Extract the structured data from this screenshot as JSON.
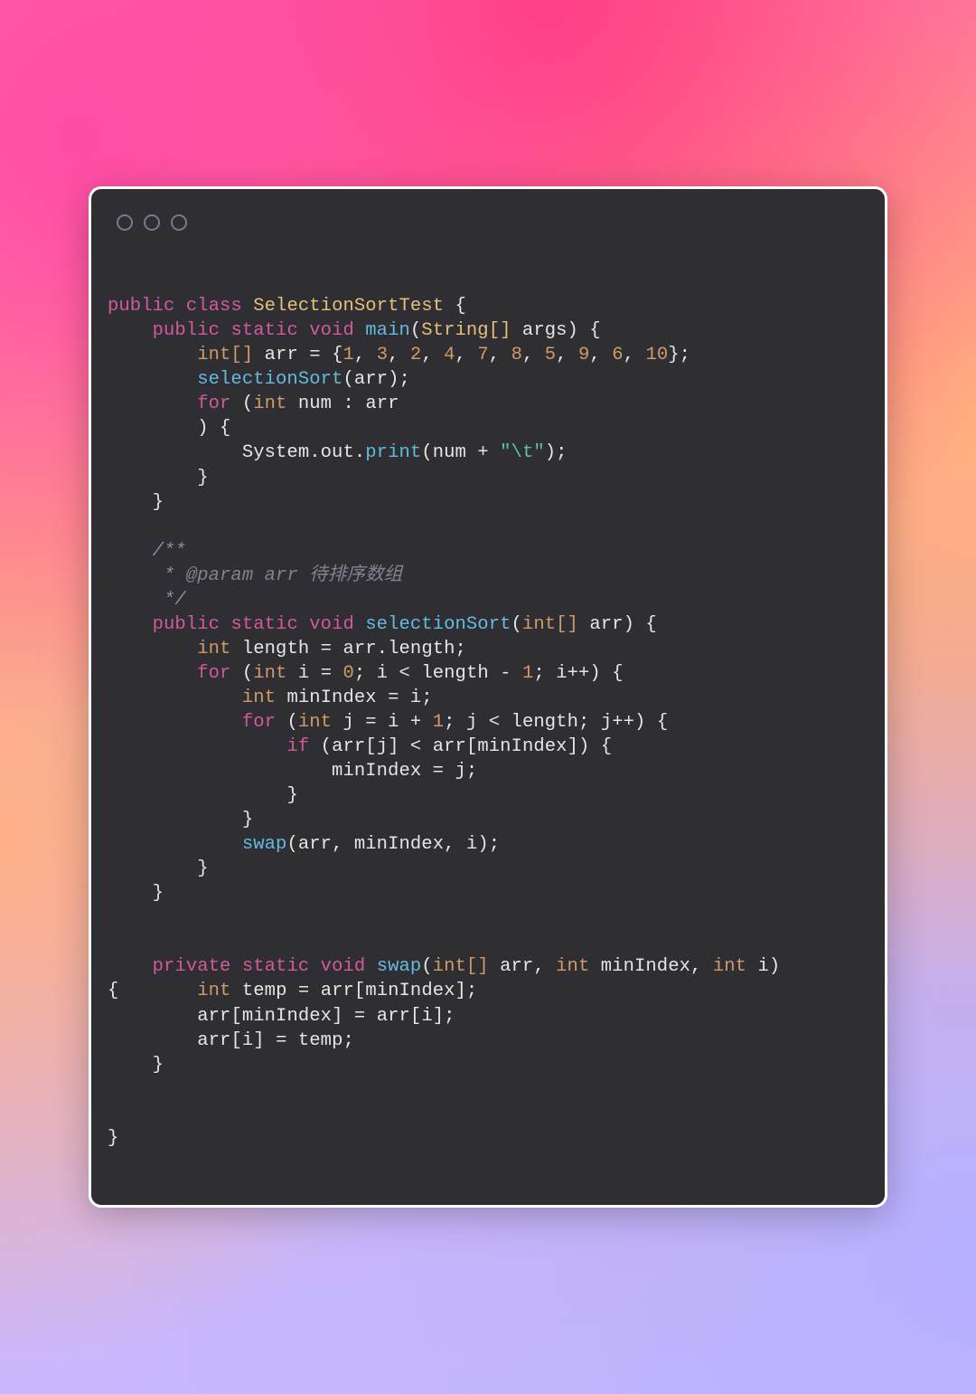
{
  "language": "java",
  "class_name": "SelectionSortTest",
  "main": {
    "modifiers": [
      "public",
      "static"
    ],
    "return_type": "void",
    "name": "main",
    "param_type": "String[]",
    "param_name": "args",
    "arr_decl_type": "int[]",
    "arr_name": "arr",
    "arr_values": [
      1,
      3,
      2,
      4,
      7,
      8,
      5,
      9,
      6,
      10
    ],
    "call": "selectionSort",
    "foreach_type": "int",
    "foreach_var": "num",
    "foreach_src": "arr",
    "print_obj": "System",
    "print_out": "out",
    "print_fn": "print",
    "print_arg_var": "num",
    "print_arg_str": "\"\\t\""
  },
  "doc": {
    "open": "/**",
    "param_tag": "@param",
    "param_name": "arr",
    "param_desc": "待排序数组",
    "close": "*/"
  },
  "selectionSort": {
    "modifiers": [
      "public",
      "static"
    ],
    "return_type": "void",
    "name": "selectionSort",
    "param_type": "int[]",
    "param_name": "arr",
    "len_type": "int",
    "len_name": "length",
    "len_src": "arr.length",
    "outer": {
      "type": "int",
      "var": "i",
      "init": "0",
      "cond_lhs": "i",
      "cond_op": "<",
      "cond_rhs": "length - 1",
      "step": "i++"
    },
    "minIndex_type": "int",
    "minIndex_name": "minIndex",
    "minIndex_init": "i",
    "inner": {
      "type": "int",
      "var": "j",
      "init": "i + 1",
      "cond_lhs": "j",
      "cond_op": "<",
      "cond_rhs": "length",
      "step": "j++"
    },
    "if_lhs": "arr[j]",
    "if_op": "<",
    "if_rhs": "arr[minIndex]",
    "if_assign_lhs": "minIndex",
    "if_assign_rhs": "j",
    "swap_call": "swap",
    "swap_args": [
      "arr",
      "minIndex",
      "i"
    ]
  },
  "swap": {
    "modifiers": [
      "private",
      "static"
    ],
    "return_type": "void",
    "name": "swap",
    "params": [
      {
        "type": "int[]",
        "name": "arr"
      },
      {
        "type": "int",
        "name": "minIndex"
      },
      {
        "type": "int",
        "name": "i"
      }
    ],
    "temp_type": "int",
    "temp_name": "temp",
    "temp_src": "arr[minIndex]",
    "line2_lhs": "arr[minIndex]",
    "line2_rhs": "arr[i]",
    "line3_lhs": "arr[i]",
    "line3_rhs": "temp"
  }
}
